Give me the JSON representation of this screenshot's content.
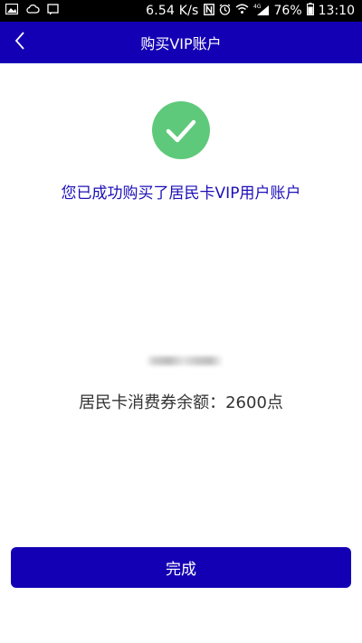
{
  "status_bar": {
    "net_speed": "6.54 K/s",
    "network_type": "4G",
    "battery": "76%",
    "time": "13:10",
    "icons": [
      "image-icon",
      "cloud-icon",
      "message-icon",
      "nfc-icon",
      "alarm-icon",
      "wifi-icon",
      "signal-icon",
      "battery-icon"
    ]
  },
  "header": {
    "title": "购买VIP账户",
    "back_icon": "chevron-left-icon"
  },
  "success": {
    "icon": "check-circle-icon",
    "message": "您已成功购买了居民卡VIP用户账户"
  },
  "balance": {
    "text": "居民卡消费券余额：2600点"
  },
  "footer": {
    "done_label": "完成"
  },
  "colors": {
    "primary": "#1400b4",
    "success_green": "#5ec97a",
    "message_text": "#1c0fb7",
    "body_text": "#333333"
  }
}
